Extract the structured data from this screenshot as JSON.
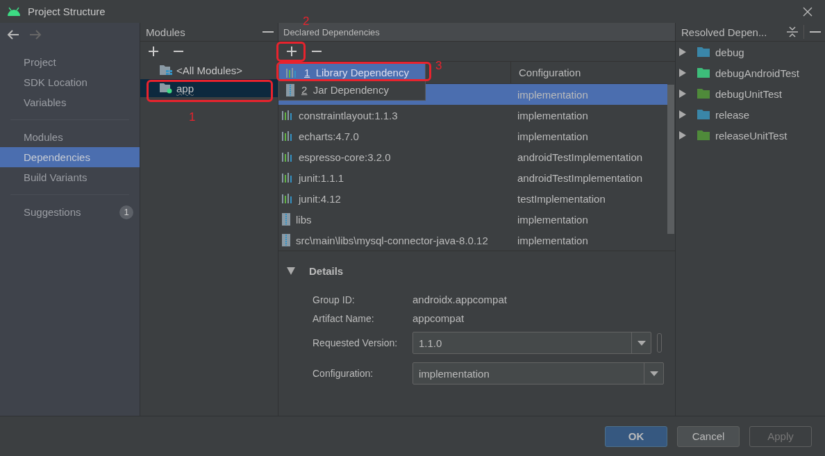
{
  "window": {
    "title": "Project Structure"
  },
  "sidebar": {
    "sections": [
      {
        "items": [
          {
            "label": "Project",
            "selected": false
          },
          {
            "label": "SDK Location",
            "selected": false
          },
          {
            "label": "Variables",
            "selected": false
          }
        ]
      },
      {
        "items": [
          {
            "label": "Modules",
            "selected": false
          },
          {
            "label": "Dependencies",
            "selected": true
          },
          {
            "label": "Build Variants",
            "selected": false
          }
        ]
      },
      {
        "items": [
          {
            "label": "Suggestions",
            "selected": false,
            "badge": "1"
          }
        ]
      }
    ]
  },
  "modules": {
    "title": "Modules",
    "items": [
      {
        "label": "<All Modules>",
        "kind": "all",
        "selected": false
      },
      {
        "label": "app",
        "kind": "module",
        "selected": true
      }
    ]
  },
  "declared": {
    "title": "Declared Dependencies",
    "config_header": "Configuration",
    "rows": [
      {
        "config": "implementation",
        "selected": true
      },
      {
        "name": "constraintlayout:1.1.3",
        "kind": "library",
        "config": "implementation",
        "selected": false
      },
      {
        "name": "echarts:4.7.0",
        "kind": "library",
        "config": "implementation",
        "selected": false
      },
      {
        "name": "espresso-core:3.2.0",
        "kind": "library",
        "config": "androidTestImplementation",
        "selected": false
      },
      {
        "name": "junit:1.1.1",
        "kind": "library",
        "config": "androidTestImplementation",
        "selected": false
      },
      {
        "name": "junit:4.12",
        "kind": "library",
        "config": "testImplementation",
        "selected": false
      },
      {
        "name": "libs",
        "kind": "jar",
        "config": "implementation",
        "selected": false
      },
      {
        "name": "src\\main\\libs\\mysql-connector-java-8.0.12",
        "kind": "jar",
        "config": "implementation",
        "selected": false
      }
    ],
    "popup": [
      {
        "number": "1",
        "label": "Library Dependency",
        "kind": "library",
        "selected": true
      },
      {
        "number": "2",
        "label": "Jar Dependency",
        "kind": "jar",
        "selected": false
      }
    ]
  },
  "details": {
    "title": "Details",
    "expanded": true,
    "fields": [
      {
        "label": "Group ID:",
        "value": "androidx.appcompat",
        "kind": "text"
      },
      {
        "label": "Artifact Name:",
        "value": "appcompat",
        "kind": "text"
      },
      {
        "label": "Requested Version:",
        "value": "1.1.0",
        "kind": "version"
      },
      {
        "label": "Configuration:",
        "value": "implementation",
        "kind": "combo"
      }
    ]
  },
  "resolved": {
    "title": "Resolved Depen...",
    "items": [
      {
        "label": "debug",
        "color": "#3a86a8"
      },
      {
        "label": "debugAndroidTest",
        "color": "#3dbd7a"
      },
      {
        "label": "debugUnitTest",
        "color": "#4f8a3a"
      },
      {
        "label": "release",
        "color": "#3a86a8"
      },
      {
        "label": "releaseUnitTest",
        "color": "#4f8a3a"
      }
    ]
  },
  "buttons": [
    {
      "label": "OK",
      "kind": "primary",
      "disabled": false
    },
    {
      "label": "Cancel",
      "kind": "normal",
      "disabled": false
    },
    {
      "label": "Apply",
      "kind": "normal",
      "disabled": true
    }
  ],
  "annotations": [
    {
      "label": "1"
    },
    {
      "label": "2"
    },
    {
      "label": "3"
    }
  ]
}
